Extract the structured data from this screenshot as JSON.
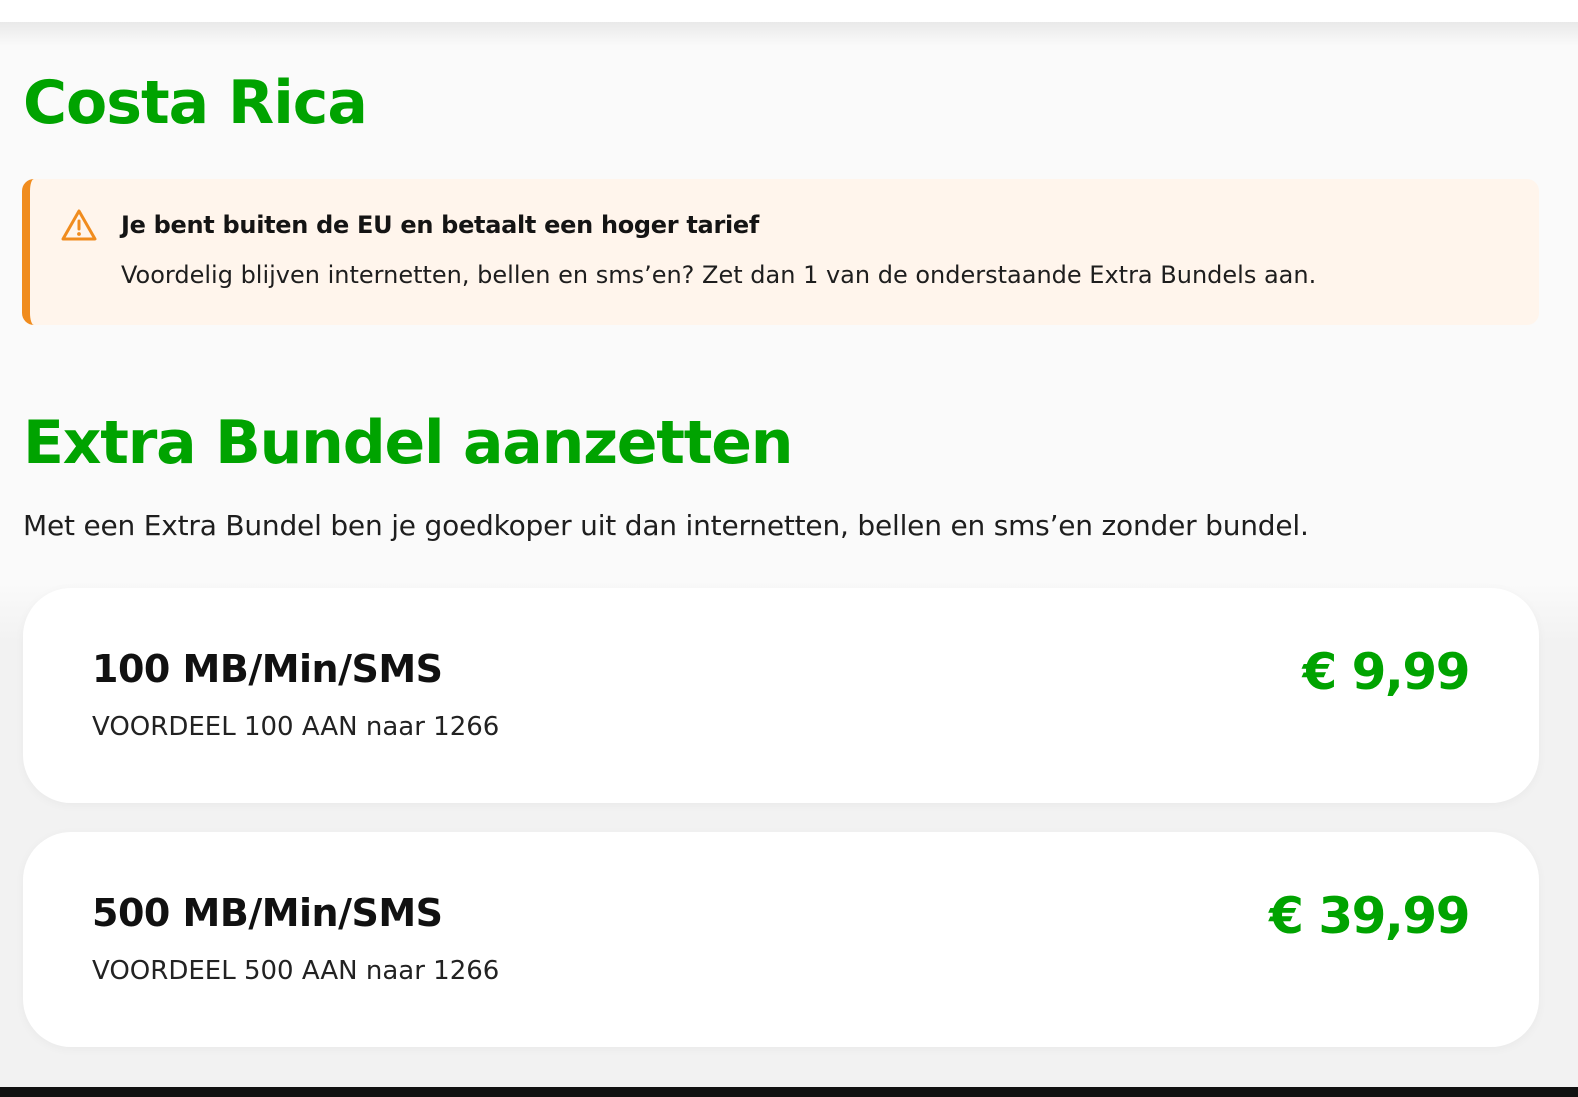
{
  "header": {
    "country": "Costa Rica"
  },
  "notice": {
    "icon": "warning-icon",
    "title": "Je bent buiten de EU en betaalt een hoger tarief",
    "text": "Voordelig blijven internetten, bellen en sms’en? Zet dan 1 van de onderstaande Extra Bundels aan."
  },
  "bundles": {
    "title": "Extra Bundel aanzetten",
    "description": "Met een Extra Bundel ben je goedkoper uit dan internetten, bellen en sms’en zonder bundel.",
    "items": [
      {
        "name": "100 MB/Min/SMS",
        "code": "VOORDEEL 100 AAN naar 1266",
        "price": "€ 9,99"
      },
      {
        "name": "500 MB/Min/SMS",
        "code": "VOORDEEL 500 AAN naar 1266",
        "price": "€ 39,99"
      }
    ]
  },
  "colors": {
    "brand_green": "#00a300",
    "warning_orange": "#f08c1e",
    "notice_background": "#fff5ec"
  }
}
